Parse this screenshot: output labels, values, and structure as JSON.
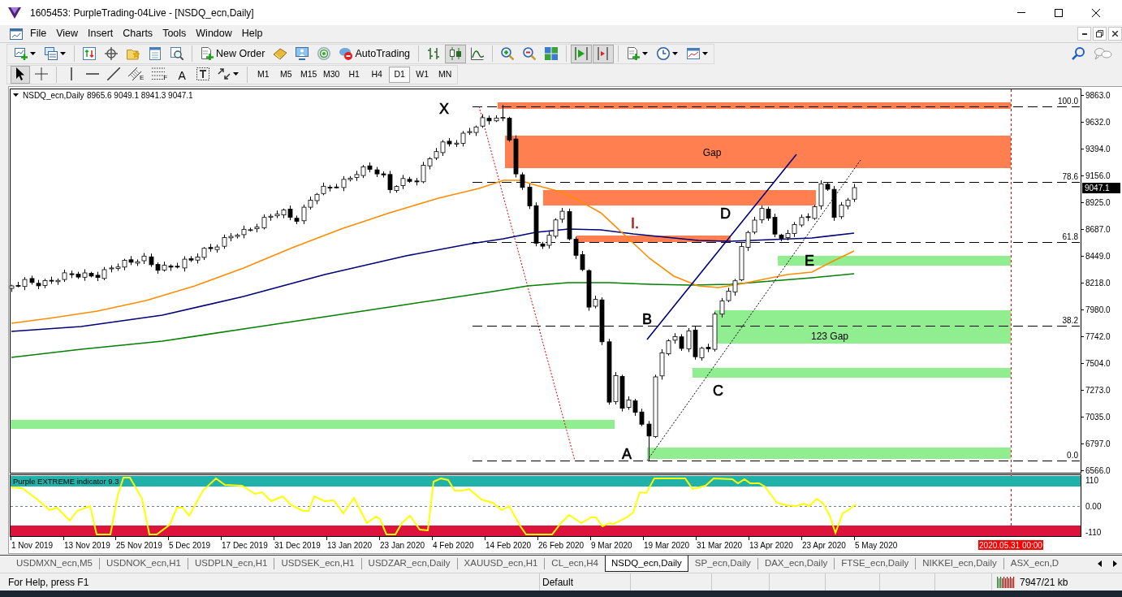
{
  "window": {
    "title": "1605453: PurpleTrading-04Live - [NSDQ_ecn,Daily]"
  },
  "menu": [
    {
      "label": "File"
    },
    {
      "label": "View"
    },
    {
      "label": "Insert"
    },
    {
      "label": "Charts"
    },
    {
      "label": "Tools"
    },
    {
      "label": "Window"
    },
    {
      "label": "Help"
    }
  ],
  "toolbar": {
    "new_order": "New Order",
    "auto_trading": {
      "label": "AutoTrading",
      "on": false
    },
    "chart_types": [
      {
        "kind": "bars",
        "selected": false
      },
      {
        "kind": "candles",
        "selected": true
      },
      {
        "kind": "line",
        "selected": false
      }
    ],
    "auto_scroll": {
      "on": true
    },
    "chart_shift": {
      "on": true
    }
  },
  "drawing_toolbar": {
    "tools": [
      {
        "kind": "cursor",
        "selected": true
      },
      {
        "kind": "crosshair",
        "selected": false
      },
      {
        "kind": "vertical-line",
        "selected": false
      },
      {
        "kind": "horizontal-line",
        "selected": false
      },
      {
        "kind": "trendline",
        "selected": false
      },
      {
        "kind": "channel",
        "mark": "E",
        "selected": false
      },
      {
        "kind": "fibonacci",
        "mark": "F",
        "selected": false
      },
      {
        "kind": "text",
        "label": "A",
        "selected": false
      },
      {
        "kind": "text-label",
        "selected": false
      },
      {
        "kind": "arrows",
        "selected": false
      }
    ],
    "timeframes": [
      {
        "label": "M1",
        "selected": false
      },
      {
        "label": "M5",
        "selected": false
      },
      {
        "label": "M15",
        "selected": false
      },
      {
        "label": "M30",
        "selected": false
      },
      {
        "label": "H1",
        "selected": false
      },
      {
        "label": "H4",
        "selected": false
      },
      {
        "label": "D1",
        "selected": true
      },
      {
        "label": "W1",
        "selected": false
      },
      {
        "label": "MN",
        "selected": false
      }
    ]
  },
  "chart": {
    "symbol": "NSDQ_ecn,Daily",
    "ohlc": "8965.6 9049.1 8941.3 9047.1",
    "price_axis": [
      "9863.0",
      "9632.0",
      "9394.0",
      "9156.0",
      "8925.0",
      "8687.0",
      "8449.0",
      "8218.0",
      "7980.0",
      "7742.0",
      "7504.0",
      "7273.0",
      "7035.0",
      "6797.0",
      "6566.0"
    ],
    "current_price": "9047.1",
    "fib_levels": [
      "100.0",
      "78.6",
      "61.8",
      "38.2",
      "0.0"
    ],
    "zones": [
      {
        "color": "#ff7f50"
      },
      {
        "color": "#ff7f50",
        "label": "Gap"
      },
      {
        "color": "#ff7f50"
      },
      {
        "color": "#ff7f50"
      },
      {
        "color": "#90ee90"
      },
      {
        "color": "#90ee90",
        "label": "123 Gap"
      },
      {
        "color": "#90ee90"
      },
      {
        "color": "#90ee90"
      },
      {
        "color": "#90ee90"
      }
    ],
    "labels": [
      {
        "text": "X",
        "kind": "point"
      },
      {
        "text": "D",
        "kind": "point"
      },
      {
        "text": "I.",
        "kind": "level"
      },
      {
        "text": "E",
        "kind": "point"
      },
      {
        "text": "B",
        "kind": "point"
      },
      {
        "text": "C",
        "kind": "point"
      },
      {
        "text": "A",
        "kind": "point"
      }
    ],
    "date_axis": [
      "1 Nov 2019",
      "13 Nov 2019",
      "25 Nov 2019",
      "5 Dec 2019",
      "17 Dec 2019",
      "31 Dec 2019",
      "13 Jan 2020",
      "23 Jan 2020",
      "4 Feb 2020",
      "14 Feb 2020",
      "26 Feb 2020",
      "9 Mar 2020",
      "19 Mar 2020",
      "31 Mar 2020",
      "13 Apr 2020",
      "23 Apr 2020",
      "5 May 2020"
    ],
    "future_time": "2020.05.31 00:00"
  },
  "indicator": {
    "title": "Purple EXTREME indicator 9.3",
    "axis": [
      "110",
      "0.00",
      "-110"
    ]
  },
  "tabs": [
    {
      "label": "USDMXN_ecn,M5",
      "selected": false
    },
    {
      "label": "USDNOK_ecn,H1",
      "selected": false
    },
    {
      "label": "USDPLN_ecn,H1",
      "selected": false
    },
    {
      "label": "USDSEK_ecn,H1",
      "selected": false
    },
    {
      "label": "USDZAR_ecn,Daily",
      "selected": false
    },
    {
      "label": "XAUUSD_ecn,H1",
      "selected": false
    },
    {
      "label": "CL_ecn,H4",
      "selected": false
    },
    {
      "label": "NSDQ_ecn,Daily",
      "selected": true
    },
    {
      "label": "SP_ecn,Daily",
      "selected": false
    },
    {
      "label": "DAX_ecn,Daily",
      "selected": false
    },
    {
      "label": "FTSE_ecn,Daily",
      "selected": false
    },
    {
      "label": "NIKKEI_ecn,Daily",
      "selected": false
    },
    {
      "label": "ASX_ecn,D",
      "selected": false
    }
  ],
  "status_bar": {
    "help": "For Help, press F1",
    "profile": "Default",
    "traffic": "7947/21 kb"
  }
}
